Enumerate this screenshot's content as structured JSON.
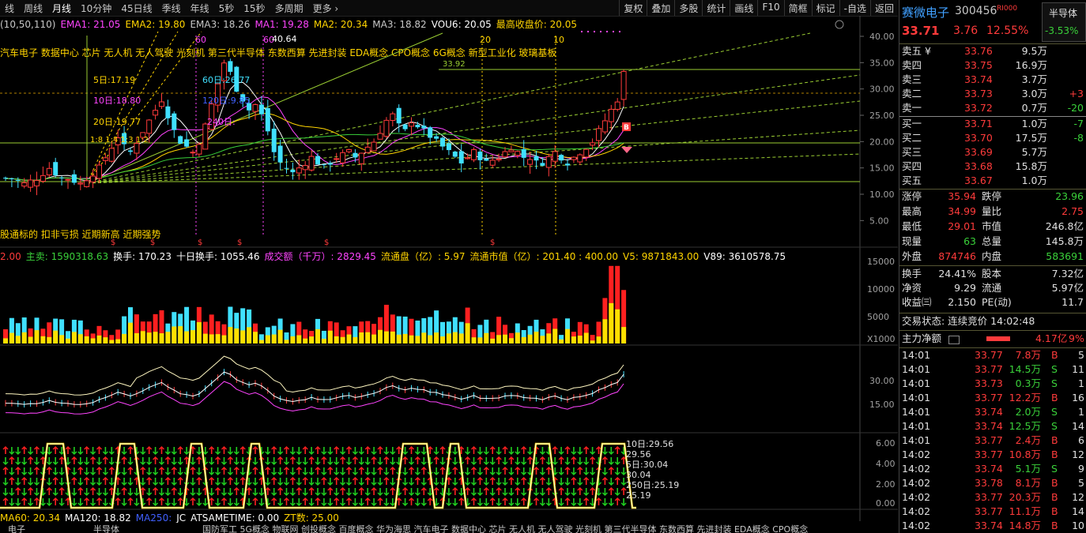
{
  "tabs": [
    "线",
    "周线",
    "月线",
    "10分钟",
    "45日线",
    "季线",
    "年线",
    "5秒",
    "15秒",
    "多周期",
    "更多 ›"
  ],
  "active_tab": "月线",
  "toolbar": [
    "复权",
    "叠加",
    "多股",
    "统计",
    "画线",
    "F10",
    "简框",
    "标记",
    "-自选",
    "返回"
  ],
  "ema_line": [
    {
      "t": "(10,50,110)",
      "c": "#c8c8c8"
    },
    {
      "t": "EMA1: 21.05",
      "c": "#ff44ff"
    },
    {
      "t": "EMA2: 19.80",
      "c": "#ffd400"
    },
    {
      "t": "EMA3: 18.26",
      "c": "#c8c8c8"
    },
    {
      "t": "MA1: 19.28",
      "c": "#ff44ff"
    },
    {
      "t": "MA2: 20.34",
      "c": "#ffd400"
    },
    {
      "t": "MA3: 18.82",
      "c": "#c8c8c8"
    },
    {
      "t": "VOU6: 20.05",
      "c": "#ffffff"
    },
    {
      "t": "最高收盘价: 20.05",
      "c": "#ffd400"
    }
  ],
  "concepts_line": "汽车电子 数据中心 芯片 无人机 无人驾驶 光刻机 第三代半导体 东数西算 先进封装 EDA概念 CPO概念 6G概念 新型工业化 玻璃基板",
  "signal_line": "股通标的 扣非亏损 近期新高 近期强势",
  "vol_line": [
    {
      "t": "2.00",
      "c": "#ff3b3b"
    },
    {
      "t": "主卖: 1590318.63",
      "c": "#3ad13a"
    },
    {
      "t": "换手: 170.23",
      "c": "#ffffff"
    },
    {
      "t": "十日换手: 1055.46",
      "c": "#ffffff"
    },
    {
      "t": "成交额（千万）: 2829.45",
      "c": "#ff44ff"
    },
    {
      "t": "流通盘（亿）: 5.97",
      "c": "#ffd400"
    },
    {
      "t": "流通市值（亿）: 201.40 : 400.00",
      "c": "#ffd400"
    },
    {
      "t": "V5: 9871843.00",
      "c": "#ffd400"
    },
    {
      "t": "V89: 3610578.75",
      "c": "#ffffff"
    }
  ],
  "bottom_line": [
    {
      "t": "MA60: 20.34",
      "c": "#ffd400"
    },
    {
      "t": "MA120: 18.82",
      "c": "#ffffff"
    },
    {
      "t": "MA250:",
      "c": "#4060ff"
    },
    {
      "t": "JC_ATSAMETIME: 0.00",
      "c": "#ffffff"
    },
    {
      "t": "ZT数: 25.00",
      "c": "#ffd400"
    }
  ],
  "footer_tabs": [
    "电子",
    "半导体",
    "国防军工 5G概念 物联网 创投概念 百度概念 华为海思 汽车电子 数据中心 芯片 无人机 无人驾驶 光刻机 第三代半导体 东数西算 先进封装 EDA概念 CPO概念"
  ],
  "chart_labels": {
    "ma_tags": [
      "5日:17.19",
      "10日:18.80",
      "20日:19.77",
      "60日:26.77",
      "120日:9.85",
      "240日:"
    ],
    "fib": "1:8 1:4 1:3 1:2",
    "peak": "40.64",
    "level": "33.92",
    "cycle_marks": [
      "60",
      "60",
      "20",
      "10"
    ],
    "y_axis": [
      "40.00",
      "35.00",
      "30.00",
      "25.00",
      "20.00",
      "15.00",
      "10.00",
      "5.00"
    ],
    "vol_axis": [
      "15000",
      "10000",
      "5000",
      "X1000"
    ],
    "mid_axis": [
      "30.00",
      "15.00"
    ],
    "bot_axis": [
      "6.00",
      "4.00",
      "2.00",
      "0.00"
    ],
    "bot_labels": [
      "10日:29.56",
      "29.56",
      "5日:30.04",
      "30.04",
      "250日:25.19",
      "25.19"
    ]
  },
  "stock": {
    "name": "赛微电子",
    "code": "300456",
    "badge": "R",
    "badge2": "I000",
    "sector": "半导体",
    "sector_chg": "-3.53%",
    "price": "33.71",
    "change": "3.76",
    "pct": "12.55%"
  },
  "asks": [
    {
      "label": "卖五 ¥",
      "price": "33.76",
      "vol": "9.5万",
      "chg": ""
    },
    {
      "label": "卖四",
      "price": "33.75",
      "vol": "16.9万",
      "chg": ""
    },
    {
      "label": "卖三",
      "price": "33.74",
      "vol": "3.7万",
      "chg": ""
    },
    {
      "label": "卖二",
      "price": "33.73",
      "vol": "3.0万",
      "chg": "+3"
    },
    {
      "label": "卖一",
      "price": "33.72",
      "vol": "0.7万",
      "chg": "-20"
    }
  ],
  "bids": [
    {
      "label": "买一",
      "price": "33.71",
      "vol": "1.0万",
      "chg": "-7"
    },
    {
      "label": "买二",
      "price": "33.70",
      "vol": "17.5万",
      "chg": "-8"
    },
    {
      "label": "买三",
      "price": "33.69",
      "vol": "5.7万",
      "chg": ""
    },
    {
      "label": "买四",
      "price": "33.68",
      "vol": "15.8万",
      "chg": ""
    },
    {
      "label": "买五",
      "price": "33.67",
      "vol": "1.0万",
      "chg": ""
    }
  ],
  "stats1": [
    {
      "k1": "涨停",
      "v1": "35.94",
      "c1": "red",
      "k2": "跌停",
      "v2": "23.96",
      "c2": "green"
    },
    {
      "k1": "最高",
      "v1": "34.99",
      "c1": "red",
      "k2": "量比",
      "v2": "2.75",
      "c2": "red"
    },
    {
      "k1": "最低",
      "v1": "29.01",
      "c1": "red",
      "k2": "市值",
      "v2": "246.8亿",
      "c2": "white"
    },
    {
      "k1": "现量",
      "v1": "63",
      "c1": "green",
      "k2": "总量",
      "v2": "145.8万",
      "c2": "white"
    },
    {
      "k1": "外盘",
      "v1": "874746",
      "c1": "red",
      "k2": "内盘",
      "v2": "583691",
      "c2": "green"
    }
  ],
  "stats2": [
    {
      "k1": "换手",
      "v1": "24.41%",
      "k2": "股本",
      "v2": "7.32亿"
    },
    {
      "k1": "净资",
      "v1": "9.29",
      "k2": "流通",
      "v2": "5.97亿"
    },
    {
      "k1": "收益㈢",
      "v1": "2.150",
      "k2": "PE(动)",
      "v2": "11.7"
    }
  ],
  "trade_state": "交易状态: 连续竞价 14:02:48",
  "main_flow": {
    "label": "主力净额",
    "value": "4.17亿",
    "pct": "9%"
  },
  "ticks": [
    {
      "t": "14:01",
      "p": "33.77",
      "v": "7.8万",
      "s": "B",
      "n": "5"
    },
    {
      "t": "14:01",
      "p": "33.77",
      "v": "14.5万",
      "s": "S",
      "n": "11"
    },
    {
      "t": "14:01",
      "p": "33.73",
      "v": "0.3万",
      "s": "S",
      "n": "1"
    },
    {
      "t": "14:01",
      "p": "33.77",
      "v": "12.2万",
      "s": "B",
      "n": "16"
    },
    {
      "t": "14:01",
      "p": "33.74",
      "v": "2.0万",
      "s": "S",
      "n": "1"
    },
    {
      "t": "14:01",
      "p": "33.74",
      "v": "12.5万",
      "s": "S",
      "n": "14"
    },
    {
      "t": "14:01",
      "p": "33.77",
      "v": "2.4万",
      "s": "B",
      "n": "6"
    },
    {
      "t": "14:02",
      "p": "33.77",
      "v": "10.8万",
      "s": "B",
      "n": "12"
    },
    {
      "t": "14:02",
      "p": "33.74",
      "v": "5.1万",
      "s": "S",
      "n": "9"
    },
    {
      "t": "14:02",
      "p": "33.78",
      "v": "8.1万",
      "s": "B",
      "n": "5"
    },
    {
      "t": "14:02",
      "p": "33.77",
      "v": "20.3万",
      "s": "B",
      "n": "12"
    },
    {
      "t": "14:02",
      "p": "33.77",
      "v": "11.1万",
      "s": "B",
      "n": "14"
    },
    {
      "t": "14:02",
      "p": "33.74",
      "v": "14.8万",
      "s": "B",
      "n": "10"
    }
  ],
  "colors": {
    "up": "#ff3b3b",
    "down": "#40e0ff",
    "ma_magenta": "#ff44ff",
    "ma_yellow": "#ffd400",
    "grid": "#8a6a00"
  }
}
